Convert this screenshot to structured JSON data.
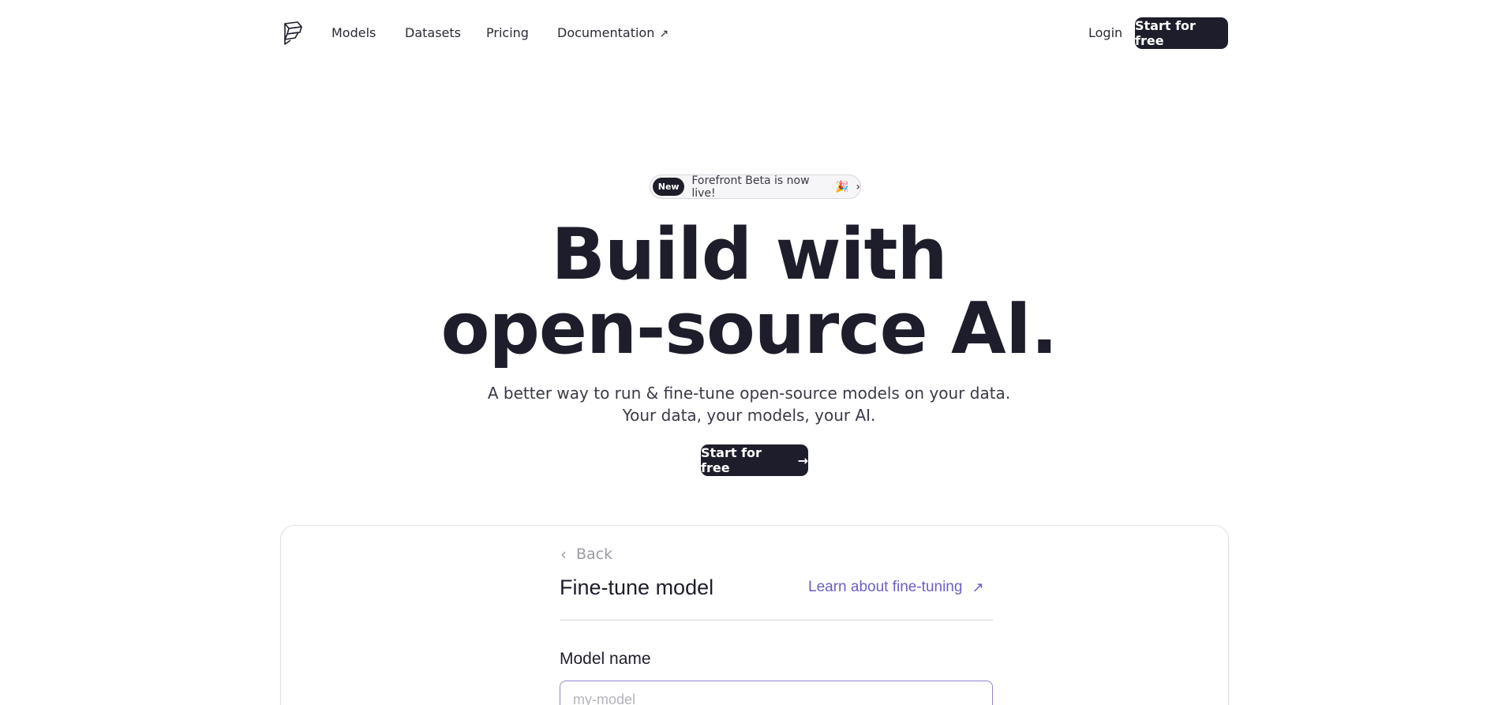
{
  "nav": {
    "logo_icon": "forefront-logo-icon",
    "links": [
      "Models",
      "Datasets",
      "Pricing",
      "Documentation"
    ],
    "docs_external_icon": "external-link-icon",
    "login_label": "Login",
    "cta_label": "Start for free"
  },
  "announcement": {
    "badge": "New",
    "text": "Forefront Beta is now live!",
    "emoji": "🎉",
    "chevron_icon": "chevron-right-icon"
  },
  "hero": {
    "title_line1": "Build with",
    "title_line2": "open-source AI.",
    "subtitle_line1": "A better way to run & fine-tune open-source models on your data.",
    "subtitle_line2": "Your data, your models, your AI.",
    "cta_label": "Start for free",
    "cta_icon": "arrow-right-icon"
  },
  "preview": {
    "back_label": "Back",
    "title": "Fine-tune model",
    "learn_link": "Learn about fine-tuning",
    "field_label": "Model name",
    "field_placeholder": "my-model",
    "field_value": ""
  },
  "colors": {
    "primary_dark": "#1e1d2b",
    "link_purple": "#6b5fc7",
    "input_focus_border": "#8f86d6"
  }
}
